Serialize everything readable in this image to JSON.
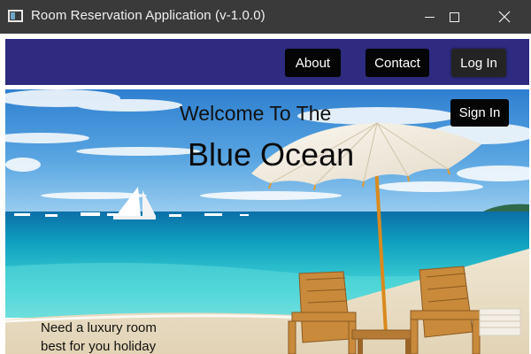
{
  "window": {
    "title": "Room Reservation Application (v-1.0.0)",
    "controls": {
      "minimize_icon": "minimize-icon",
      "maximize_icon": "maximize-icon",
      "close_icon": "close-icon",
      "close_glyph": "✕"
    }
  },
  "navbar": {
    "background": "#2e2b80",
    "items": [
      {
        "label": "About"
      },
      {
        "label": "Contact"
      },
      {
        "label": "Log In"
      }
    ]
  },
  "hero": {
    "welcome": "Welcome To The",
    "brand": "Blue Ocean",
    "sign_in": "Sign In",
    "tagline_line1": "Need a luxury room",
    "tagline_line2": "best for you holiday",
    "image": "beach-umbrella-photo",
    "colors": {
      "sky": "#3b8fd6",
      "sea": "#16a8c4",
      "sand": "#e9dfc8"
    }
  }
}
